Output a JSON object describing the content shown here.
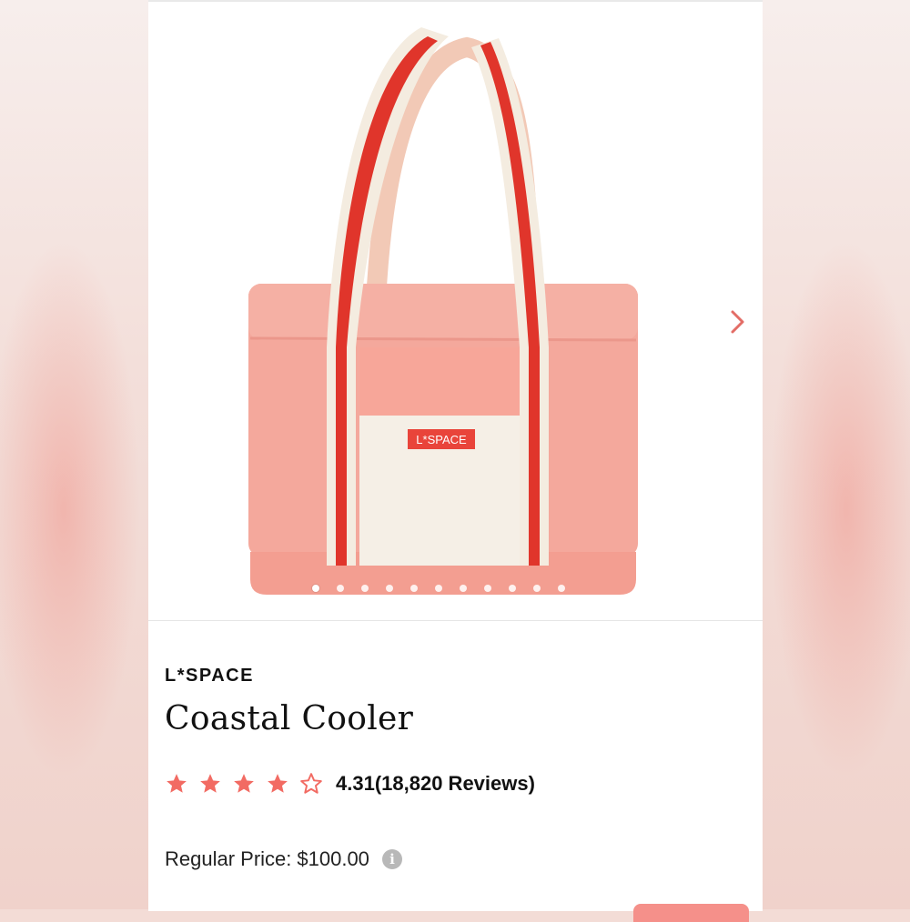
{
  "product": {
    "brand": "L*SPACE",
    "title": "Coastal Cooler",
    "bag_logo": "L*SPACE",
    "rating": {
      "value": "4.31",
      "count_label": "(18,820 Reviews)",
      "stars_value": 4.31,
      "stars_max": 5
    },
    "price": {
      "label": "Regular Price:",
      "amount": "$100.00"
    }
  },
  "carousel": {
    "total_images": 11,
    "active_index": 0
  },
  "colors": {
    "accent": "#f26b63",
    "bag_body": "#f4a69a",
    "strap_red": "#e0352b",
    "strap_cream": "#f4ece0"
  },
  "icons": {
    "next": "chevron-right-icon",
    "info": "info-icon",
    "star": "star-icon"
  }
}
